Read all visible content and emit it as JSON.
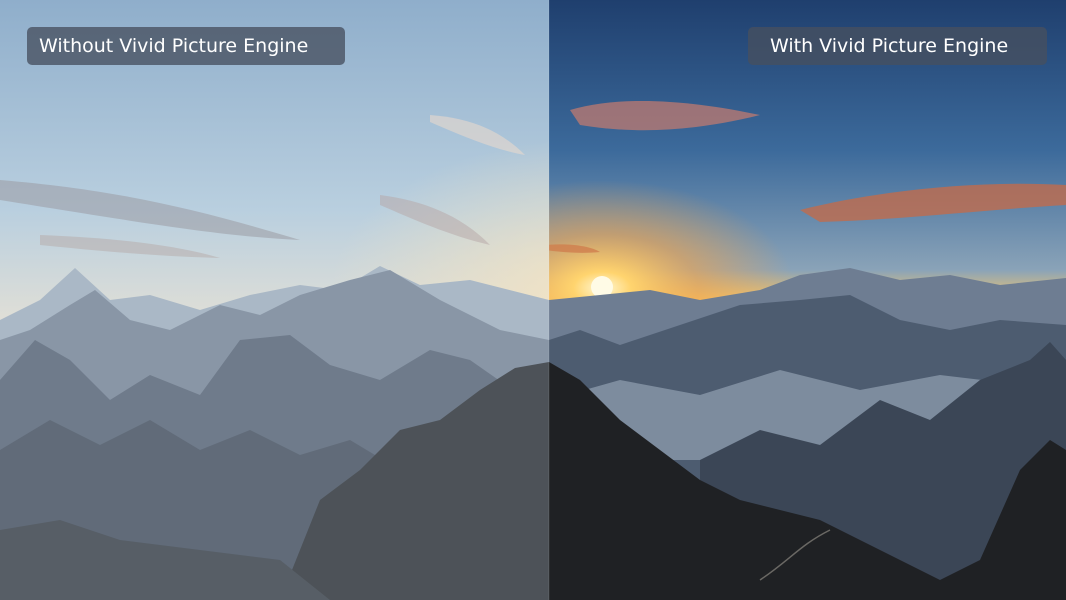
{
  "labels": {
    "left": "Without Vivid Picture Engine",
    "right": "With Vivid Picture Engine"
  },
  "scene": {
    "subject": "mountain-sunrise",
    "left_tone": "washed-out",
    "right_tone": "vivid"
  },
  "colors": {
    "label_bg": "#46505f",
    "label_text": "#ffffff"
  }
}
